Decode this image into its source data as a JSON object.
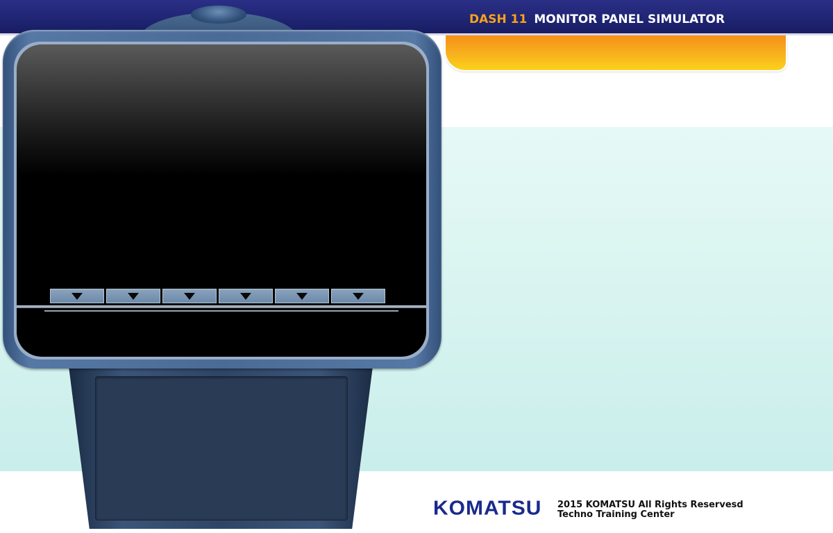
{
  "header": {
    "dash_label": "DASH 11",
    "title": "MONITOR PANEL SIMULATOR"
  },
  "monitor": {
    "function_keys": [
      {
        "icon": "triangle-down-icon"
      },
      {
        "icon": "triangle-down-icon"
      },
      {
        "icon": "triangle-down-icon"
      },
      {
        "icon": "triangle-down-icon"
      },
      {
        "icon": "triangle-down-icon"
      },
      {
        "icon": "triangle-down-icon"
      }
    ]
  },
  "footer": {
    "logo_text": "KOMATSU",
    "copyright_line1": "2015 KOMATSU All Rights Reservesd",
    "copyright_line2": "Techno Training Center"
  },
  "colors": {
    "header_bg": "#1f2472",
    "dash_accent": "#f5a21b",
    "tab_gradient_top": "#f58f1a",
    "tab_gradient_bottom": "#fbd21d",
    "content_bg": "#d8f4f0",
    "logo_blue": "#1a2a8c",
    "bezel_blue": "#4a6b96"
  }
}
